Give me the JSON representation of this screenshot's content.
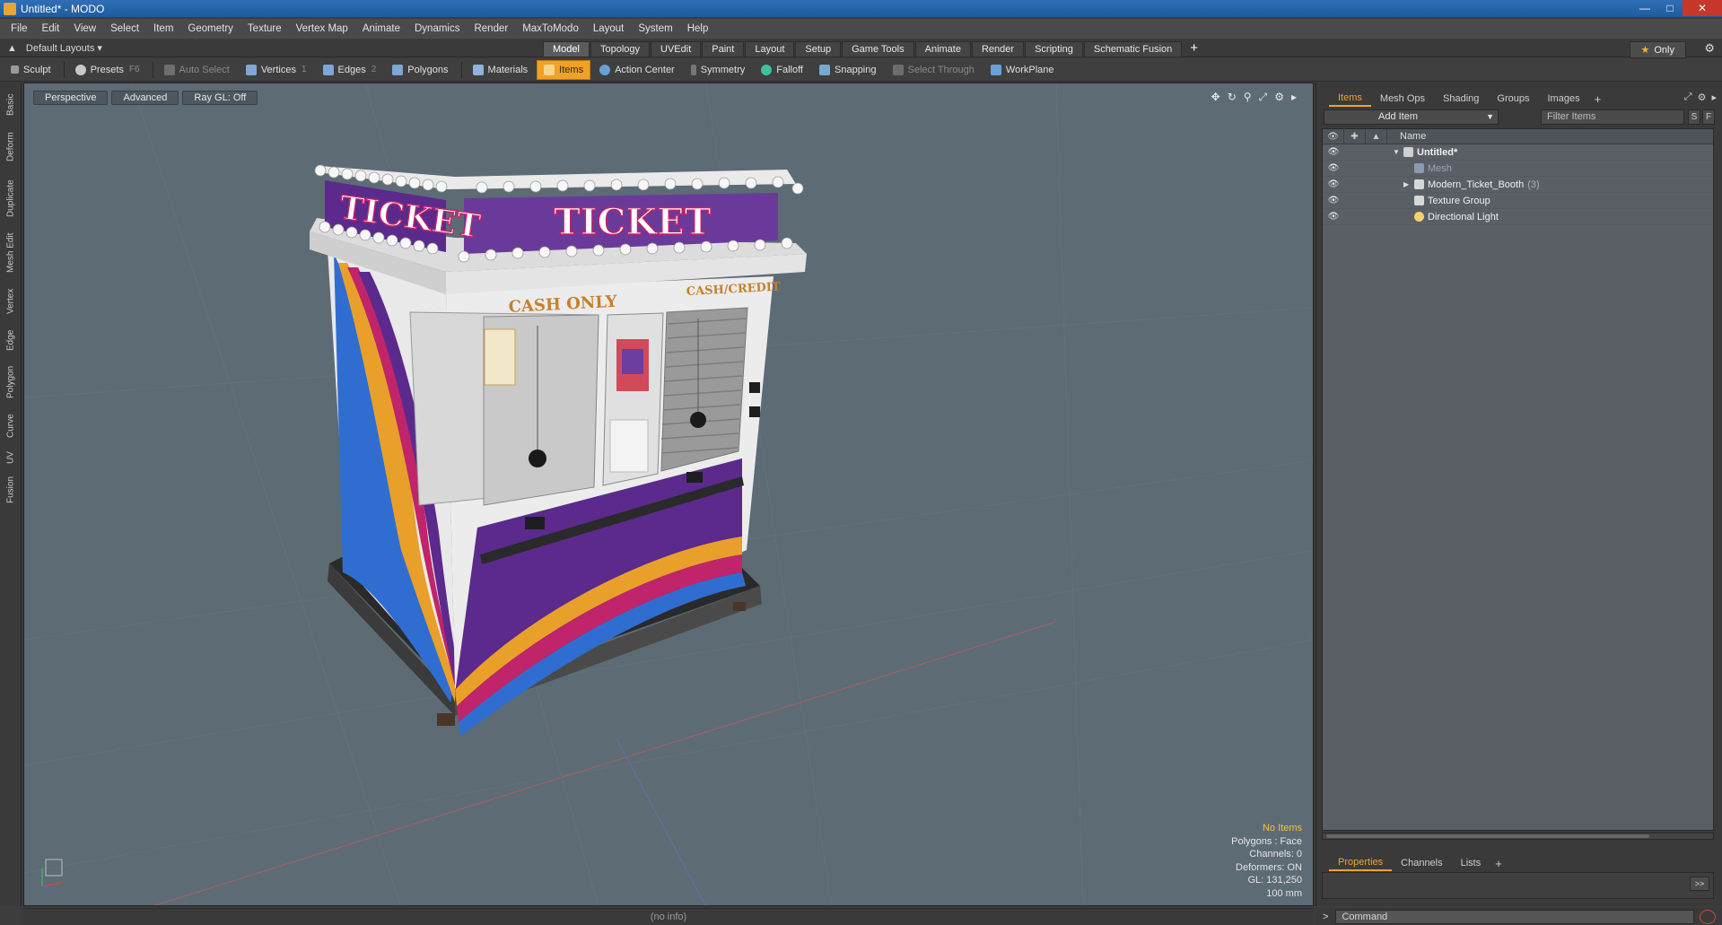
{
  "window": {
    "title": "Untitled* - MODO"
  },
  "menubar": [
    "File",
    "Edit",
    "View",
    "Select",
    "Item",
    "Geometry",
    "Texture",
    "Vertex Map",
    "Animate",
    "Dynamics",
    "Render",
    "MaxToModo",
    "Layout",
    "System",
    "Help"
  ],
  "layoutbar": {
    "layout_name": "Default Layouts",
    "tabs": [
      "Model",
      "Topology",
      "UVEdit",
      "Paint",
      "Layout",
      "Setup",
      "Game Tools",
      "Animate",
      "Render",
      "Scripting",
      "Schematic Fusion"
    ],
    "active_tab": "Model",
    "only_label": "Only"
  },
  "toolbar": {
    "sculpt": "Sculpt",
    "presets": "Presets",
    "presets_hotkey": "F6",
    "auto_select": "Auto Select",
    "vertices": "Vertices",
    "vertices_hotkey": "1",
    "edges": "Edges",
    "edges_hotkey": "2",
    "polygons": "Polygons",
    "materials": "Materials",
    "items": "Items",
    "action_center": "Action Center",
    "symmetry": "Symmetry",
    "falloff": "Falloff",
    "snapping": "Snapping",
    "select_through": "Select Through",
    "workplane": "WorkPlane"
  },
  "left_tabs": [
    "Basic",
    "Deform",
    "Duplicate",
    "Mesh Edit",
    "Vertex",
    "Edge",
    "Polygon",
    "Curve",
    "UV",
    "Fusion"
  ],
  "viewport": {
    "view_mode": "Perspective",
    "shading": "Advanced",
    "raygl": "Ray GL: Off",
    "booth_sign": "TICKET",
    "cash_only": "CASH ONLY",
    "cash_credit": "CASH/CREDIT",
    "info": {
      "selection": "No Items",
      "polygons": "Polygons : Face",
      "channels": "Channels: 0",
      "deformers": "Deformers: ON",
      "gl": "GL: 131,250",
      "scale": "100 mm"
    }
  },
  "items_panel": {
    "tabs": [
      "Items",
      "Mesh Ops",
      "Shading",
      "Groups",
      "Images"
    ],
    "active_tab": "Items",
    "add_item": "Add Item",
    "filter_placeholder": "Filter Items",
    "filter_s": "S",
    "filter_f": "F",
    "column_name": "Name",
    "rows": [
      {
        "name": "Untitled*"
      },
      {
        "name": "Mesh"
      },
      {
        "name": "Modern_Ticket_Booth",
        "count": "(3)"
      },
      {
        "name": "Texture Group"
      },
      {
        "name": "Directional Light"
      }
    ]
  },
  "properties_panel": {
    "tabs": [
      "Properties",
      "Channels",
      "Lists"
    ],
    "active_tab": "Properties",
    "expand": ">>"
  },
  "statusbar": {
    "info": "(no info)"
  },
  "commandbar": {
    "prompt": ">",
    "placeholder": "Command"
  },
  "colors": {
    "accent": "#f0a128",
    "viewport_bg": "#5d6b75",
    "booth_purple": "#5b2a8c",
    "booth_orange": "#e8a02a",
    "booth_magenta": "#c0246a",
    "booth_blue": "#2f6ed0"
  }
}
